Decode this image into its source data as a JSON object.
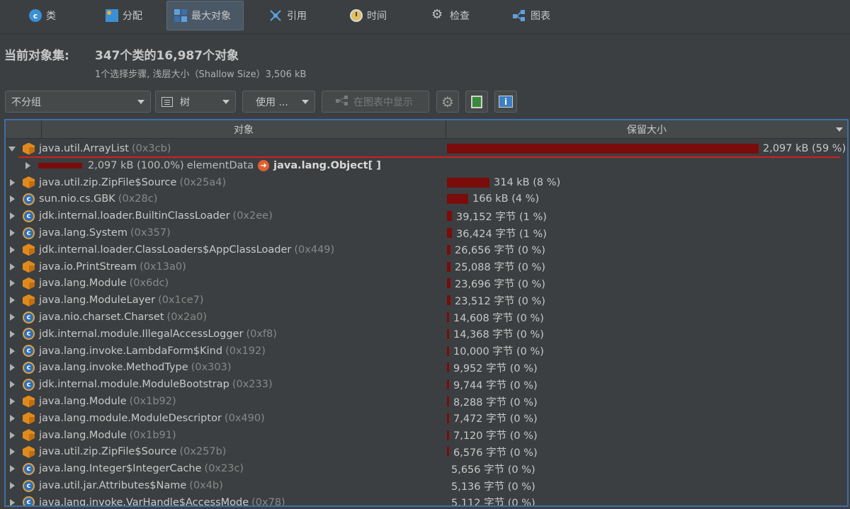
{
  "tabs": [
    {
      "label": "类",
      "icon": "class-icon",
      "active": false
    },
    {
      "label": "分配",
      "icon": "allocation-icon",
      "active": false
    },
    {
      "label": "最大对象",
      "icon": "biggest-objects-icon",
      "active": true
    },
    {
      "label": "引用",
      "icon": "references-icon",
      "active": false
    },
    {
      "label": "时间",
      "icon": "time-icon",
      "active": false
    },
    {
      "label": "检查",
      "icon": "inspections-icon",
      "active": false
    },
    {
      "label": "图表",
      "icon": "graphs-icon",
      "active": false
    }
  ],
  "header": {
    "label": "当前对象集:",
    "title": "347个类的16,987个对象",
    "subtitle": "1个选择步骤, 浅层大小（Shallow Size）3,506 kB"
  },
  "toolbar": {
    "grouping": "不分组",
    "view": "树",
    "use_label": "使用 ...",
    "show_in_graph": "在图表中显示"
  },
  "table": {
    "columns": [
      "对象",
      "保留大小"
    ],
    "expanded_child": {
      "size": "2,097 kB (100.0%)",
      "field": "elementData",
      "target": "java.lang.Object[ ]"
    },
    "rows": [
      {
        "icon": "cube",
        "name": "java.util.ArrayList",
        "addr": "(0x3cb)",
        "size": "2,097 kB (59 %)",
        "bar": 0.59,
        "expanded": true
      },
      {
        "icon": "cube",
        "name": "java.util.zip.ZipFile$Source",
        "addr": "(0x25a4)",
        "size": "314 kB (8 %)",
        "bar": 0.08
      },
      {
        "icon": "class",
        "name": "sun.nio.cs.GBK",
        "addr": "(0x28c)",
        "size": "166 kB (4 %)",
        "bar": 0.04
      },
      {
        "icon": "class",
        "name": "jdk.internal.loader.BuiltinClassLoader",
        "addr": "(0x2ee)",
        "size": "39,152 字节 (1 %)",
        "bar": 0.01
      },
      {
        "icon": "class",
        "name": "java.lang.System",
        "addr": "(0x357)",
        "size": "36,424 字节 (1 %)",
        "bar": 0.01
      },
      {
        "icon": "cube",
        "name": "jdk.internal.loader.ClassLoaders$AppClassLoader",
        "addr": "(0x449)",
        "size": "26,656 字节 (0 %)",
        "bar": 0.007
      },
      {
        "icon": "cube",
        "name": "java.io.PrintStream",
        "addr": "(0x13a0)",
        "size": "25,088 字节 (0 %)",
        "bar": 0.007
      },
      {
        "icon": "cube",
        "name": "java.lang.Module",
        "addr": "(0x6dc)",
        "size": "23,696 字节 (0 %)",
        "bar": 0.007
      },
      {
        "icon": "cube",
        "name": "java.lang.ModuleLayer",
        "addr": "(0x1ce7)",
        "size": "23,512 字节 (0 %)",
        "bar": 0.007
      },
      {
        "icon": "class",
        "name": "java.nio.charset.Charset",
        "addr": "(0x2a0)",
        "size": "14,608 字节 (0 %)",
        "bar": 0.004
      },
      {
        "icon": "class",
        "name": "jdk.internal.module.IllegalAccessLogger",
        "addr": "(0xf8)",
        "size": "14,368 字节 (0 %)",
        "bar": 0.004
      },
      {
        "icon": "class",
        "name": "java.lang.invoke.LambdaForm$Kind",
        "addr": "(0x192)",
        "size": "10,000 字节 (0 %)",
        "bar": 0.003
      },
      {
        "icon": "class",
        "name": "java.lang.invoke.MethodType",
        "addr": "(0x303)",
        "size": "9,952 字节 (0 %)",
        "bar": 0.003
      },
      {
        "icon": "class",
        "name": "jdk.internal.module.ModuleBootstrap",
        "addr": "(0x233)",
        "size": "9,744 字节 (0 %)",
        "bar": 0.003
      },
      {
        "icon": "cube",
        "name": "java.lang.Module",
        "addr": "(0x1b92)",
        "size": "8,288 字节 (0 %)",
        "bar": 0.002
      },
      {
        "icon": "cube",
        "name": "java.lang.module.ModuleDescriptor",
        "addr": "(0x490)",
        "size": "7,472 字节 (0 %)",
        "bar": 0.002
      },
      {
        "icon": "cube",
        "name": "java.lang.Module",
        "addr": "(0x1b91)",
        "size": "7,120 字节 (0 %)",
        "bar": 0.002
      },
      {
        "icon": "cube",
        "name": "java.util.zip.ZipFile$Source",
        "addr": "(0x257b)",
        "size": "6,576 字节 (0 %)",
        "bar": 0.002
      },
      {
        "icon": "class",
        "name": "java.lang.Integer$IntegerCache",
        "addr": "(0x23c)",
        "size": "5,656 字节 (0 %)",
        "bar": 0
      },
      {
        "icon": "class",
        "name": "java.util.jar.Attributes$Name",
        "addr": "(0x4b)",
        "size": "5,136 字节 (0 %)",
        "bar": 0
      },
      {
        "icon": "class",
        "name": "java.lang.invoke.VarHandle$AccessMode",
        "addr": "(0x78)",
        "size": "5,112 字节 (0 %)",
        "bar": 0
      }
    ]
  }
}
